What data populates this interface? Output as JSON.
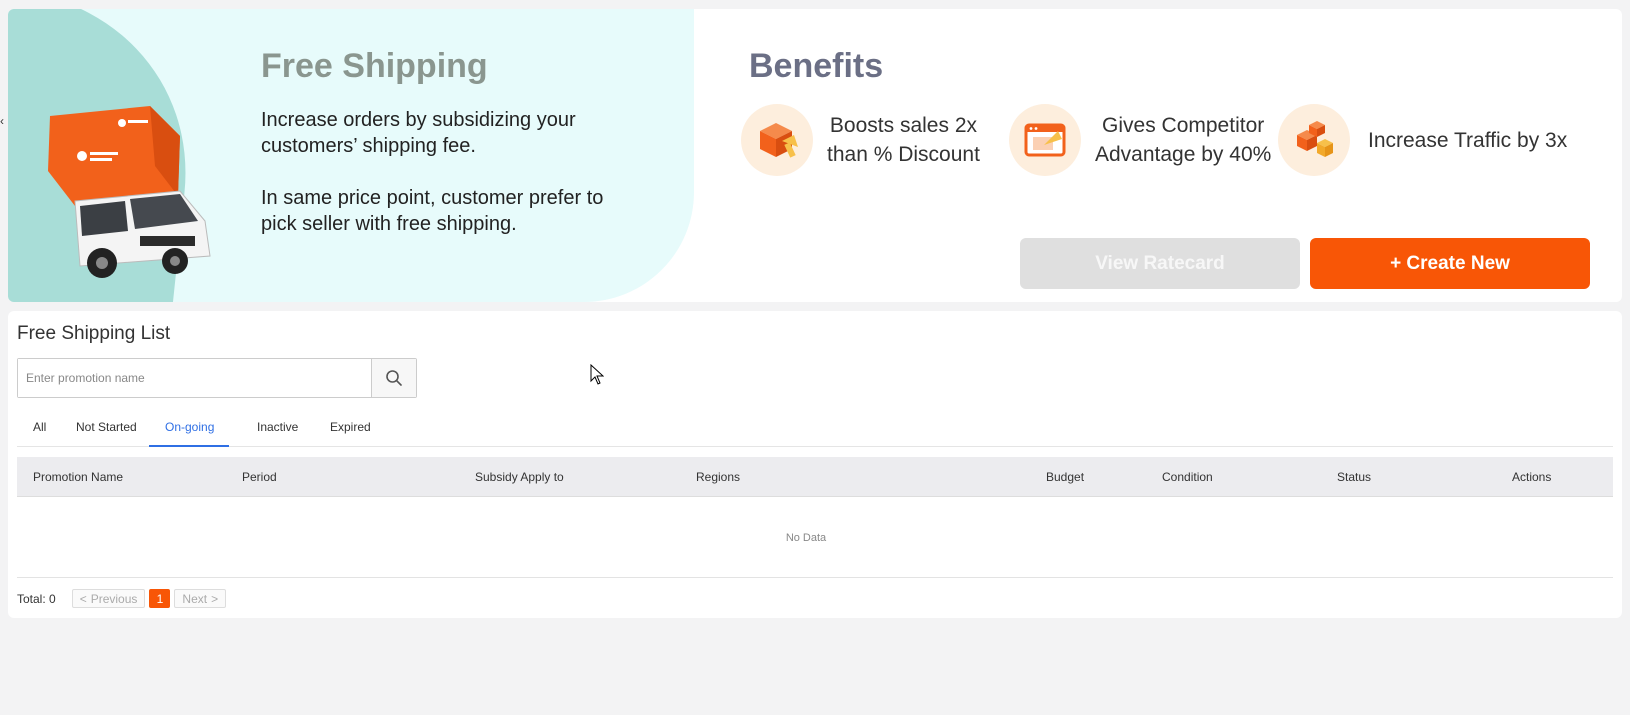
{
  "banner": {
    "title": "Free Shipping",
    "line1": "Increase orders by subsidizing your customers’ shipping fee.",
    "line2": "In same price point, customer prefer to pick seller with free shipping.",
    "benefits_title": "Benefits",
    "benefits": [
      {
        "icon": "box-arrow-icon",
        "label_a": "Boosts sales 2x",
        "label_b": "than % Discount"
      },
      {
        "icon": "browser-arrow-icon",
        "label_a": "Gives Competitor",
        "label_b": "Advantage by 40%"
      },
      {
        "icon": "boxes-traffic-icon",
        "label_a": "Increase Traffic by 3x",
        "label_b": ""
      }
    ],
    "view_ratecard": "View Ratecard",
    "create_new": "+ Create New",
    "accent": "#f85606"
  },
  "list": {
    "title": "Free Shipping List",
    "search_placeholder": "Enter promotion name",
    "tabs": [
      "All",
      "Not Started",
      "On-going",
      "Inactive",
      "Expired"
    ],
    "active_tab": "On-going",
    "columns": [
      "Promotion Name",
      "Period",
      "Subsidy Apply to",
      "Regions",
      "Budget",
      "Condition",
      "Status",
      "Actions"
    ],
    "empty_text": "No Data",
    "total_label": "Total: 0",
    "prev_label": "Previous",
    "next_label": "Next",
    "current_page": "1"
  }
}
